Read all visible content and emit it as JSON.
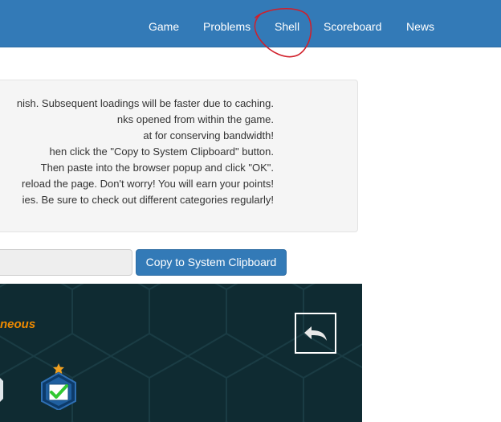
{
  "nav": {
    "items": [
      {
        "id": "game",
        "label": "Game"
      },
      {
        "id": "problems",
        "label": "Problems"
      },
      {
        "id": "shell",
        "label": "Shell"
      },
      {
        "id": "scoreboard",
        "label": "Scoreboard"
      },
      {
        "id": "news",
        "label": "News"
      }
    ]
  },
  "annotation": {
    "color": "#d11f2a"
  },
  "instructions": {
    "lines": [
      "nish. Subsequent loadings will be faster due to caching.",
      "nks opened from within the game.",
      "at for conserving bandwidth!",
      "hen click the \"Copy to System Clipboard\" button.",
      "Then paste into the browser popup and click \"OK\".",
      "reload the page. Don't worry! You will earn your points!",
      "ies. Be sure to check out different categories regularly!"
    ]
  },
  "clipboard": {
    "input_value": "",
    "button_label": "Copy to System Clipboard"
  },
  "game": {
    "title_fragment": "neous",
    "back_icon": "back-arrow-icon",
    "badge_icon": "checkmark-badge-icon",
    "colors": {
      "background": "#0f2b32",
      "title": "#ee8a00",
      "badge": "#1f5fa0",
      "check": "#32c832",
      "star": "#f0a020"
    }
  }
}
